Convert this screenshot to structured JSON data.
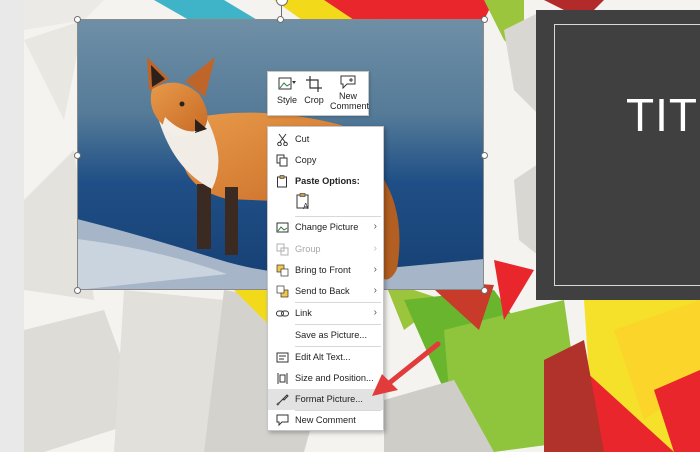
{
  "slide": {
    "title_placeholder": "TITL"
  },
  "mini_toolbar": {
    "style_label": "Style",
    "crop_label": "Crop",
    "new_comment_label_line1": "New",
    "new_comment_label_line2": "Comment"
  },
  "context_menu": {
    "items": [
      {
        "label": "Cut",
        "icon": "scissors-icon"
      },
      {
        "label": "Copy",
        "icon": "copy-icon"
      },
      {
        "label": "Paste Options:",
        "icon": "clipboard-icon"
      },
      {
        "label": "Change Picture",
        "icon": "change-picture-icon"
      },
      {
        "label": "Group",
        "icon": "group-icon"
      },
      {
        "label": "Bring to Front",
        "icon": "bring-to-front-icon"
      },
      {
        "label": "Send to Back",
        "icon": "send-to-back-icon"
      },
      {
        "label": "Link",
        "icon": "link-icon"
      },
      {
        "label": "Save as Picture...",
        "icon": ""
      },
      {
        "label": "Edit Alt Text...",
        "icon": "alt-text-icon"
      },
      {
        "label": "Size and Position...",
        "icon": "size-position-icon"
      },
      {
        "label": "Format Picture...",
        "icon": "format-picture-icon"
      },
      {
        "label": "New Comment",
        "icon": "comment-icon"
      }
    ]
  },
  "colors": {
    "arrow": "#e23b3b",
    "title_box": "#404040",
    "highlight": "#e2e2e2"
  }
}
